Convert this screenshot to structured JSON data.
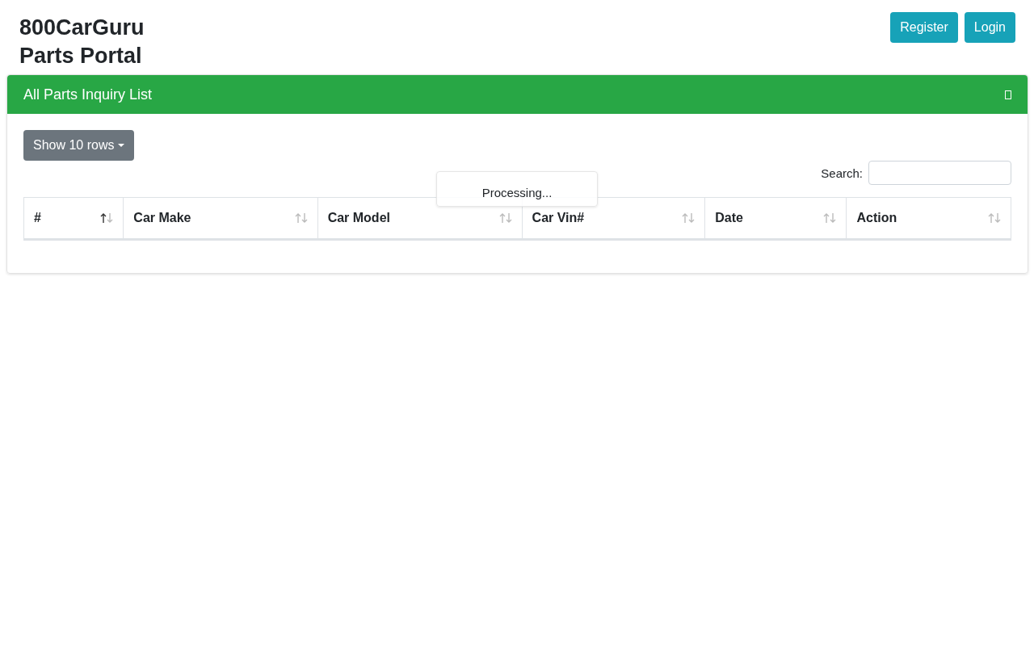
{
  "brand": {
    "lines": [
      "800CarGuru",
      "Parts Portal"
    ]
  },
  "nav_buttons": [
    "Register",
    "Login"
  ],
  "panel": {
    "title": "All Parts Inquiry List"
  },
  "length_button": {
    "label": "Show 10 rows"
  },
  "search": {
    "label": "Search:"
  },
  "processing": {
    "text": "Processing..."
  },
  "table": {
    "columns": [
      {
        "label": "#",
        "sorted": true
      },
      {
        "label": "Car Make",
        "sorted": false
      },
      {
        "label": "Car Model",
        "sorted": false
      },
      {
        "label": "Car Vin#",
        "sorted": false
      },
      {
        "label": "Date",
        "sorted": false
      },
      {
        "label": "Action",
        "sorted": false
      }
    ]
  }
}
